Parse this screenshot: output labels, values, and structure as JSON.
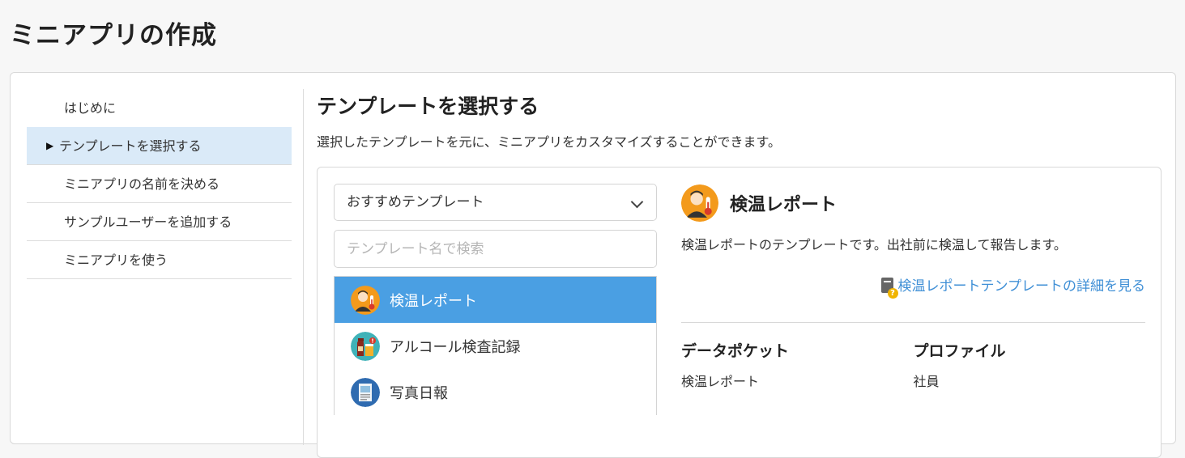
{
  "page": {
    "title": "ミニアプリの作成"
  },
  "steps": [
    {
      "label": "はじめに"
    },
    {
      "label": "テンプレートを選択する",
      "active": true
    },
    {
      "label": "ミニアプリの名前を決める"
    },
    {
      "label": "サンプルユーザーを追加する"
    },
    {
      "label": "ミニアプリを使う"
    }
  ],
  "section": {
    "title": "テンプレートを選択する",
    "description": "選択したテンプレートを元に、ミニアプリをカスタマイズすることができます。"
  },
  "filter": {
    "selected": "おすすめテンプレート",
    "search_placeholder": "テンプレート名で検索"
  },
  "templates": [
    {
      "name": "検温レポート",
      "icon": "thermometer-person-icon",
      "selected": true
    },
    {
      "name": "アルコール検査記録",
      "icon": "alcohol-bottle-icon"
    },
    {
      "name": "写真日報",
      "icon": "photo-report-icon"
    }
  ],
  "detail": {
    "title": "検温レポート",
    "icon": "thermometer-person-icon",
    "description": "検温レポートのテンプレートです。出社前に検温して報告します。",
    "link_label": "検温レポートテンプレートの詳細を見る",
    "datapocket_label": "データポケット",
    "datapocket_value": "検温レポート",
    "profile_label": "プロファイル",
    "profile_value": "社員"
  },
  "colors": {
    "accent": "#4a9fe3",
    "active_step_bg": "#daeaf8",
    "link": "#3f8fd6",
    "icon_orange": "#f39a1c"
  }
}
